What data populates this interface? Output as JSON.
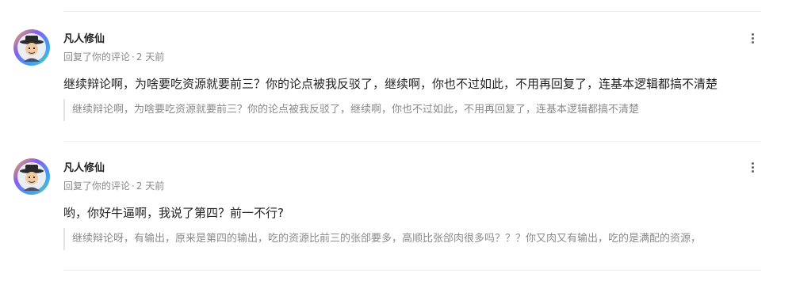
{
  "notifications": [
    {
      "user": "凡人修仙",
      "action": "回复了你的评论",
      "separator": "·",
      "time": "2 天前",
      "reply": "继续辩论啊，为啥要吃资源就要前三？你的论点被我反驳了，继续啊，你也不过如此，不用再回复了，连基本逻辑都搞不清楚",
      "quote": "继续辩论啊，为啥要吃资源就要前三？你的论点被我反驳了，继续啊，你也不过如此，不用再回复了，连基本逻辑都搞不清楚",
      "avatar_icon": "avatar-icon",
      "more_icon": "more-vertical-icon"
    },
    {
      "user": "凡人修仙",
      "action": "回复了你的评论",
      "separator": "·",
      "time": "2 天前",
      "reply": "哟，你好牛逼啊，我说了第四？前一不行?",
      "quote": "继续辩论呀，有输出，原来是第四的输出，吃的资源比前三的张郃要多，高顺比张郃肉很多吗？？？你又肉又有输出，吃的是满配的资源，",
      "avatar_icon": "avatar-icon",
      "more_icon": "more-vertical-icon"
    }
  ],
  "colors": {
    "text": "#222222",
    "meta": "#8a8a8a",
    "quote_border": "#e2e2e2",
    "divider": "#eeeeee",
    "avatar_ring_purple": "#8a5cf0",
    "avatar_ring_blue": "#3fa0f0"
  }
}
